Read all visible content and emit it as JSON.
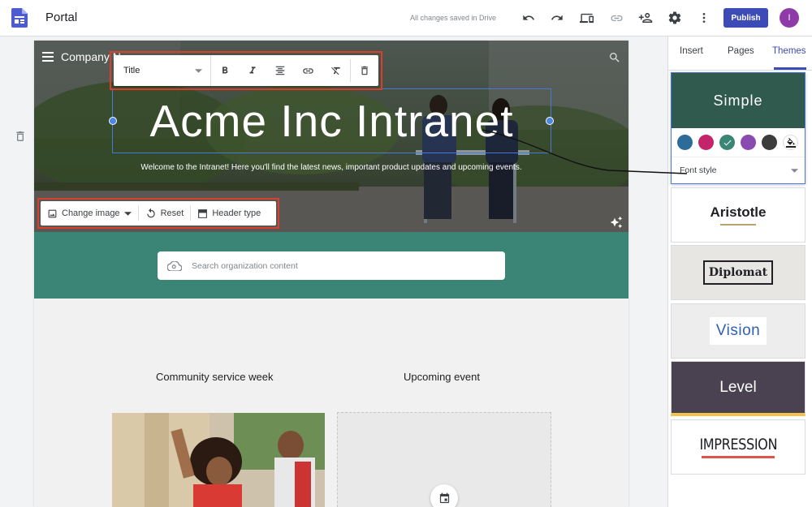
{
  "app": {
    "title": "Portal",
    "save_status": "All changes saved in Drive",
    "publish_label": "Publish",
    "avatar_initial": "I"
  },
  "topbar_icons": [
    "undo-icon",
    "redo-icon",
    "preview-icon",
    "link-icon",
    "share-icon",
    "settings-icon",
    "more-icon"
  ],
  "header": {
    "company_name": "Company N",
    "title": "Acme Inc Intranet",
    "subtitle": "Welcome to the Intranet! Here you'll find the latest news, important product updates and upcoming events."
  },
  "format_toolbar": {
    "style_value": "Title"
  },
  "image_toolbar": {
    "change_image": "Change image",
    "reset": "Reset",
    "header_type": "Header type"
  },
  "search": {
    "placeholder": "Search organization content"
  },
  "sections": {
    "left": "Community service week",
    "right": "Upcoming event"
  },
  "panel": {
    "tabs": [
      "Insert",
      "Pages",
      "Themes"
    ],
    "active_tab": "Themes",
    "simple": {
      "name": "Simple",
      "font_style_label": "Font style"
    },
    "swatches": [
      "#2d6b9a",
      "#c2256a",
      "#3a8575",
      "#8a4ab0",
      "#3c3c3c"
    ],
    "themes": [
      "Aristotle",
      "Diplomat",
      "Vision",
      "Level",
      "IMPRESSION"
    ]
  },
  "colors": {
    "accent": "#3c4bb5",
    "band": "#3a8575",
    "selection_border": "#d93f2a"
  }
}
